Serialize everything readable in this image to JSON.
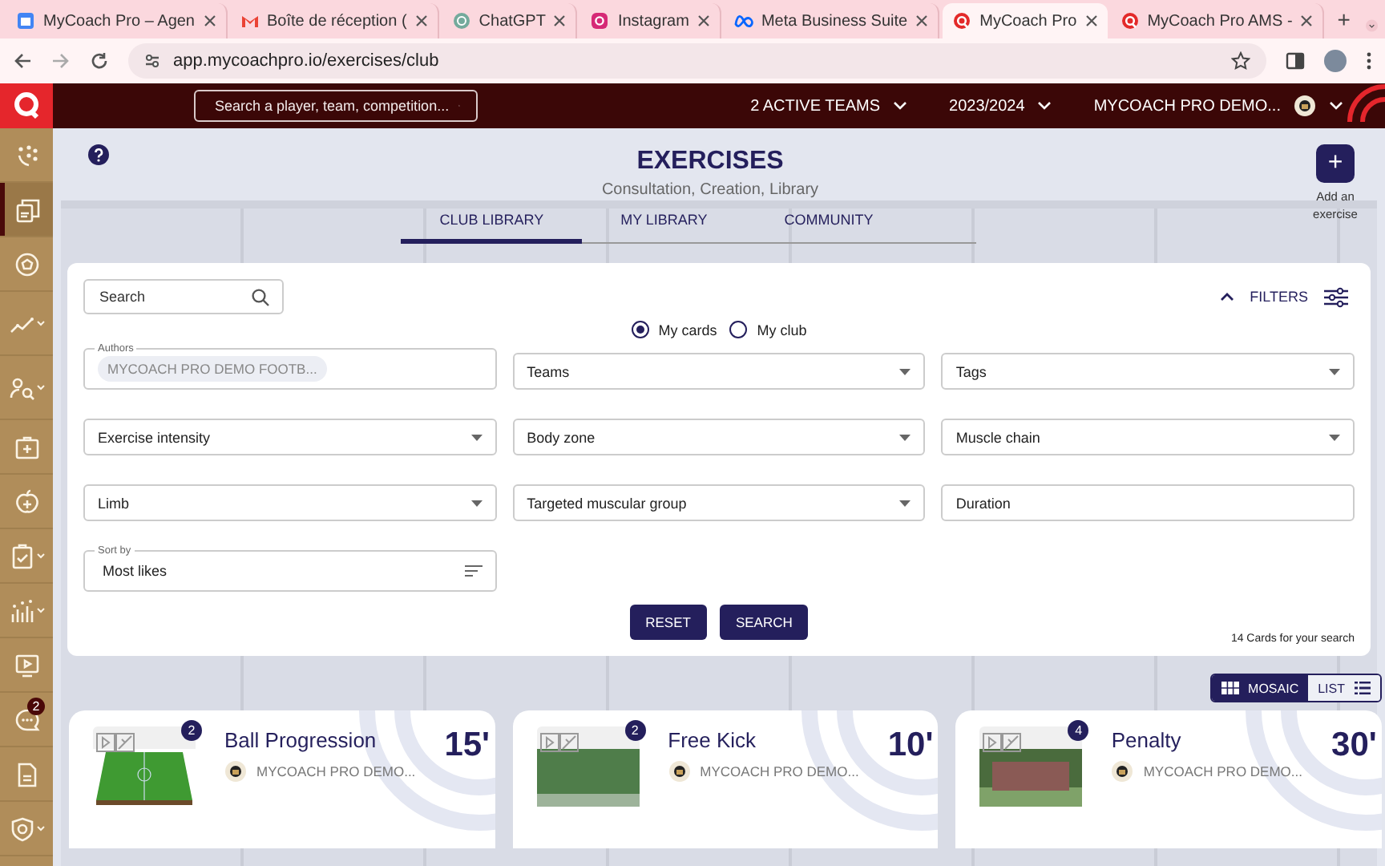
{
  "browser": {
    "tabs": [
      {
        "title": "MyCoach Pro – Agen",
        "kind": "calendar",
        "selected": false
      },
      {
        "title": "Boîte de réception (",
        "kind": "mail",
        "selected": false
      },
      {
        "title": "ChatGPT",
        "kind": "chat",
        "selected": false
      },
      {
        "title": "Instagram",
        "kind": "camera",
        "selected": false
      },
      {
        "title": "Meta Business Suite",
        "kind": "meta",
        "selected": false
      },
      {
        "title": "MyCoach Pro",
        "kind": "app",
        "selected": true
      },
      {
        "title": "MyCoach Pro AMS -",
        "kind": "app",
        "selected": false
      }
    ],
    "new_tab": "+",
    "url": "app.mycoachpro.io/exercises/club"
  },
  "top_bar": {
    "search_placeholder": "Search a player, team, competition...",
    "teams": "2 ACTIVE TEAMS",
    "season": "2023/2024",
    "club": "MYCOACH PRO DEMO..."
  },
  "sidebar": {
    "items": [
      {
        "kind": "board",
        "selected": false,
        "expandable": false
      },
      {
        "kind": "cards",
        "selected": true,
        "expandable": false
      },
      {
        "kind": "ball",
        "selected": false,
        "expandable": false
      },
      {
        "kind": "trend",
        "selected": false,
        "expandable": true
      },
      {
        "kind": "scout",
        "selected": false,
        "expandable": true
      },
      {
        "kind": "medical",
        "selected": false,
        "expandable": false
      },
      {
        "kind": "nutrition",
        "selected": false,
        "expandable": false
      },
      {
        "kind": "clipboard",
        "selected": false,
        "expandable": true
      },
      {
        "kind": "stats",
        "selected": false,
        "expandable": true
      },
      {
        "kind": "video",
        "selected": false,
        "expandable": false
      },
      {
        "kind": "message",
        "selected": false,
        "expandable": false,
        "badge": "2"
      },
      {
        "kind": "document",
        "selected": false,
        "expandable": false
      },
      {
        "kind": "shield",
        "selected": false,
        "expandable": true
      }
    ]
  },
  "page": {
    "title": "EXERCISES",
    "subtitle": "Consultation, Creation, Library",
    "add_label": "Add an exercise",
    "add_symbol": "+"
  },
  "library_tabs": [
    {
      "label": "CLUB LIBRARY",
      "selected": true
    },
    {
      "label": "MY LIBRARY",
      "selected": false
    },
    {
      "label": "COMMUNITY",
      "selected": false
    }
  ],
  "filters": {
    "search_placeholder": "Search",
    "label": "FILTERS",
    "expanded": true,
    "radios": [
      {
        "label": "My cards",
        "selected": true
      },
      {
        "label": "My club",
        "selected": false
      }
    ],
    "fields": [
      {
        "kind": "chips",
        "label": "Authors",
        "chips": [
          "MYCOACH PRO DEMO FOOTB..."
        ]
      },
      {
        "kind": "select",
        "text": "Teams"
      },
      {
        "kind": "select",
        "text": "Tags"
      },
      {
        "kind": "select",
        "text": "Exercise intensity"
      },
      {
        "kind": "select",
        "text": "Body zone"
      },
      {
        "kind": "select",
        "text": "Muscle chain"
      },
      {
        "kind": "select",
        "text": "Limb"
      },
      {
        "kind": "select",
        "text": "Targeted muscular group"
      },
      {
        "kind": "text",
        "placeholder": "Duration"
      },
      {
        "kind": "sort",
        "label": "Sort by",
        "value": "Most likes"
      }
    ],
    "buttons": [
      "RESET",
      "SEARCH"
    ],
    "result_count": "14 Cards for your search"
  },
  "view_toggle": [
    {
      "label": "MOSAIC",
      "kind": "grid",
      "selected": true
    },
    {
      "label": "LIST",
      "kind": "list",
      "selected": false
    }
  ],
  "cards": [
    {
      "title": "Ball Progression",
      "author": "MYCOACH PRO DEMO...",
      "duration": "15'",
      "media_count": "2",
      "kind": "pitch"
    },
    {
      "title": "Free Kick",
      "author": "MYCOACH PRO DEMO...",
      "duration": "10'",
      "media_count": "2",
      "kind": "field"
    },
    {
      "title": "Penalty",
      "author": "MYCOACH PRO DEMO...",
      "duration": "30'",
      "media_count": "4",
      "kind": "goal"
    }
  ]
}
